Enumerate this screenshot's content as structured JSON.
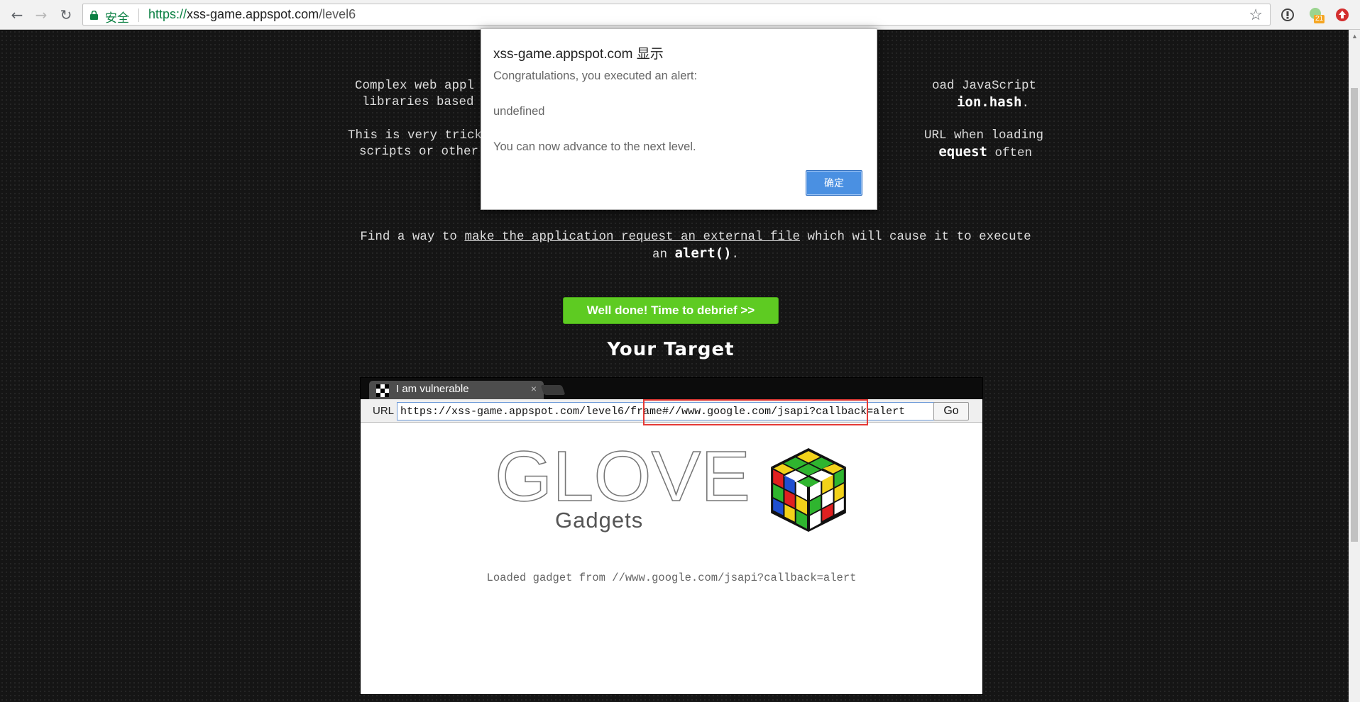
{
  "browser": {
    "secure_label": "安全",
    "url_scheme": "https://",
    "url_host": "xss-game.appspot.com",
    "url_path": "/level6",
    "extension_badge": "21"
  },
  "page": {
    "intro_line1_a": "Complex web appl",
    "intro_line1_b": "oad JavaScript",
    "intro_line2_a": "libraries based",
    "intro_line2_code": "ion.hash",
    "intro_line2_end": ".",
    "intro_line3_a": "This is very trick",
    "intro_line3_b": "URL when loading",
    "intro_line4_a": "scripts or other",
    "intro_line4_code": "equest",
    "intro_line4_b": "often",
    "mission_pre": "Find a way to",
    "mission_link": "make the application request an external file",
    "mission_post": "which will cause it to execute",
    "mission_line2_pre": "an",
    "mission_code": "alert()",
    "mission_line2_post": ".",
    "debrief_button": "Well done! Time to debrief >>",
    "target_title": "Your Target"
  },
  "frame": {
    "tab_title": "I am vulnerable",
    "tab_close": "×",
    "url_label": "URL",
    "url_value": "https://xss-game.appspot.com/level6/frame#//www.google.com/jsapi?callback=alert",
    "go_button": "Go",
    "logo_word": "GLOVE",
    "logo_sub": "Gadgets",
    "loaded_message": "Loaded gadget from //www.google.com/jsapi?callback=alert"
  },
  "dialog": {
    "title": "xss-game.appspot.com 显示",
    "line1": "Congratulations, you executed an alert:",
    "line2": "undefined",
    "line3": "You can now advance to the next level.",
    "ok_button": "确定"
  },
  "colors": {
    "accent_green": "#5ecb22",
    "dialog_button": "#4a90e2",
    "highlight": "#e53935"
  }
}
